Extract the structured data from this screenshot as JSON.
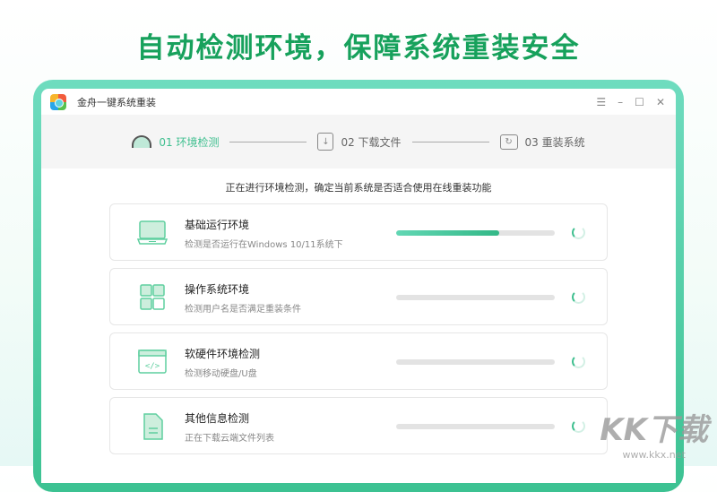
{
  "headline": "自动检测环境，保障系统重装安全",
  "window": {
    "title": "金舟一键系统重装",
    "menu_icon": "menu-icon",
    "minimize_icon": "minimize-icon",
    "maximize_icon": "maximize-icon",
    "close_icon": "close-icon"
  },
  "steps": [
    {
      "label": "01 环境检测",
      "active": true
    },
    {
      "label": "02 下载文件",
      "active": false
    },
    {
      "label": "03 重装系统",
      "active": false
    }
  ],
  "subtitle": "正在进行环境检测，确定当前系统是否适合使用在线重装功能",
  "checks": [
    {
      "title": "基础运行环境",
      "desc": "检测是否运行在Windows 10/11系统下",
      "progress": 65,
      "icon": "laptop-icon"
    },
    {
      "title": "操作系统环境",
      "desc": "检测用户名是否满足重装条件",
      "progress": 0,
      "icon": "grid-icon"
    },
    {
      "title": "软硬件环境检测",
      "desc": "检测移动硬盘/U盘",
      "progress": 0,
      "icon": "code-window-icon"
    },
    {
      "title": "其他信息检测",
      "desc": "正在下载云端文件列表",
      "progress": 0,
      "icon": "document-icon"
    }
  ],
  "watermark": {
    "brand": "KK下载",
    "url": "www.kkx.net"
  },
  "colors": {
    "accent": "#3fbf8f",
    "headline": "#17a15c"
  }
}
